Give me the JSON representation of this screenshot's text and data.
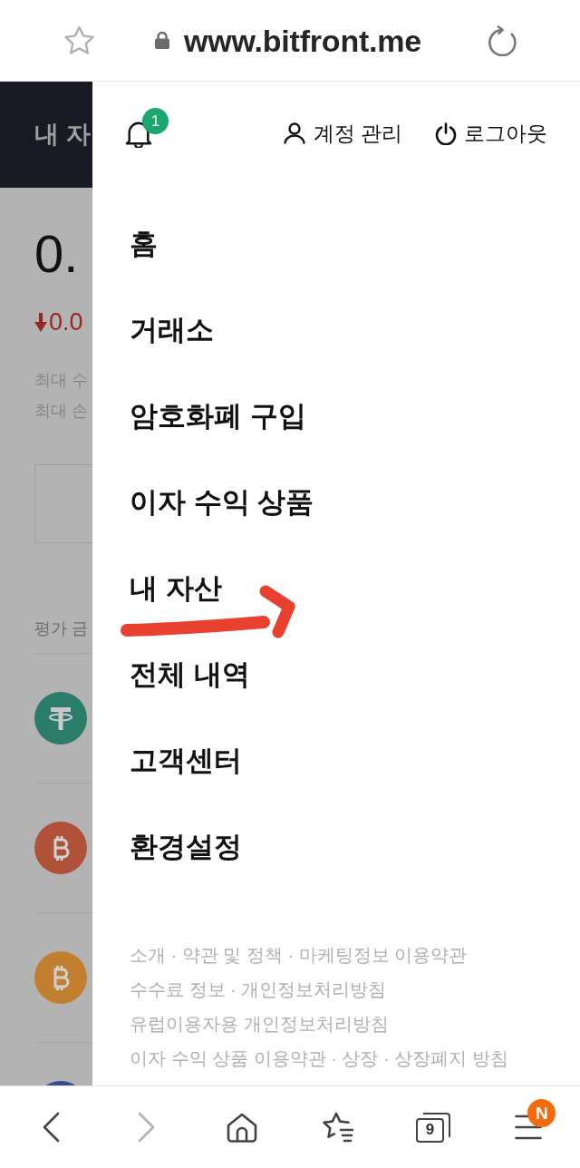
{
  "browser": {
    "url": "www.bitfront.me"
  },
  "background_page": {
    "title": "내 자",
    "balance": "0.",
    "change": {
      "down": true,
      "value": "0.0"
    },
    "stats": [
      "최대 수",
      "최대 손"
    ],
    "section_label": "평가 금",
    "coins": [
      {
        "kind": "tether",
        "color": "#2b7c69"
      },
      {
        "kind": "bitcoin",
        "color": "#b0523a"
      },
      {
        "kind": "bitcoin",
        "color": "#c27f30"
      },
      {
        "kind": "plain",
        "color": "#3d4a8a"
      }
    ]
  },
  "drawer": {
    "notification_badge": "1",
    "account": "계정 관리",
    "logout": "로그아웃",
    "menu": [
      {
        "label": "홈"
      },
      {
        "label": "거래소"
      },
      {
        "label": "암호화폐 구입"
      },
      {
        "label": "이자 수익 상품"
      },
      {
        "label": "내 자산"
      },
      {
        "label": "전체 내역"
      },
      {
        "label": "고객센터"
      },
      {
        "label": "환경설정"
      }
    ],
    "footer_links": [
      "소개 · 약관 및 정책 · 마케팅정보 이용약관",
      "수수료 정보 · 개인정보처리방침",
      "유럽이용자용 개인정보처리방침",
      "이자 수익 상품 이용약관 · 상장 · 상장폐지 방침"
    ]
  },
  "bottom_nav": {
    "back": {
      "disabled": false
    },
    "forward": {
      "disabled": true
    },
    "tab_count": "9",
    "menu_badge": "N"
  }
}
